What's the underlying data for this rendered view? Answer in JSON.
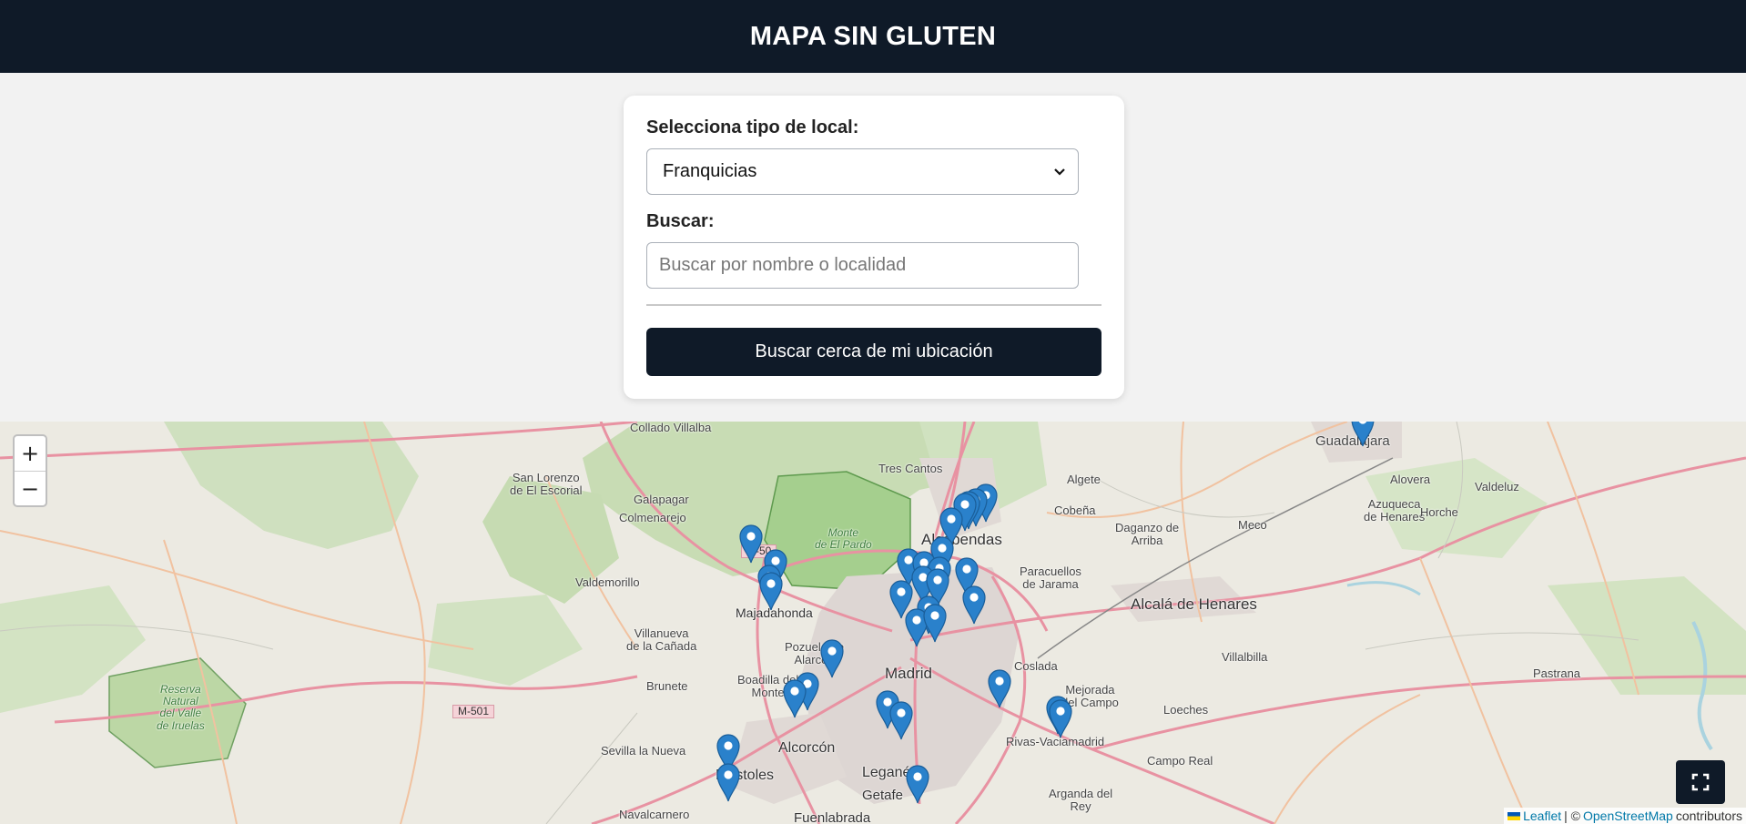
{
  "header": {
    "title": "MAPA SIN GLUTEN"
  },
  "filters": {
    "type_label": "Selecciona tipo de local:",
    "type_selected": "Franquicias",
    "search_label": "Buscar:",
    "search_placeholder": "Buscar por nombre o localidad",
    "nearby_button": "Buscar cerca de mi ubicación"
  },
  "map": {
    "zoom_in": "+",
    "zoom_out": "−",
    "attribution": {
      "leaflet": "Leaflet",
      "separator": "| ©",
      "osm": "OpenStreetMap",
      "contributors": "contributors"
    },
    "colors": {
      "header": "#0f1a28",
      "marker": "#2a81cb",
      "link": "#0078a8"
    },
    "places": {
      "guadalajara": "Guadalajara",
      "collado_villalba": "Collado Villalba",
      "san_lorenzo": "San Lorenzo\nde El Escorial",
      "tres_cantos": "Tres Cantos",
      "algete": "Algete",
      "alovera": "Alovera",
      "azuqueca": "Azuqueca\nde Henares",
      "valdeluz": "Valdeluz",
      "horche": "Horche",
      "galapagar": "Galapagar",
      "colmenarejo": "Colmenarejo",
      "monte_pardo": "Monte\nde El Pardo",
      "alcobendas": "Alcobendas",
      "cobena": "Cobeña",
      "daganzo": "Daganzo de\nArriba",
      "meco": "Meco",
      "valdemorillo": "Valdemorillo",
      "majadahonda": "Majadahonda",
      "paracuellos": "Paracuellos\nde Jarama",
      "alcala": "Alcalá de Henares",
      "villanueva": "Villanueva\nde la Cañada",
      "pozuelo": "Pozuelo de\nAlarcón",
      "villalbilla": "Villalbilla",
      "boadilla": "Boadilla del\nMonte",
      "madrid": "Madrid",
      "coslada": "Coslada",
      "pastrana": "Pastrana",
      "brunete": "Brunete",
      "mejorada": "Mejorada\ndel Campo",
      "loeches": "Loeches",
      "reserva": "Reserva\nNatural\ndel Valle\nde Iruelas",
      "m501": "M-501",
      "m50": "M-50",
      "sevilla": "Sevilla la Nueva",
      "alcorcon": "Alcorcón",
      "rivas": "Rivas-Vaciamadrid",
      "mostoles": "Móstoles",
      "leganes": "Leganés",
      "campo_real": "Campo Real",
      "getafe": "Getafe",
      "arganda": "Arganda del\nRey",
      "navalcarnero": "Navalcarnero",
      "fuenlabrada": "Fuenlabrada"
    }
  }
}
